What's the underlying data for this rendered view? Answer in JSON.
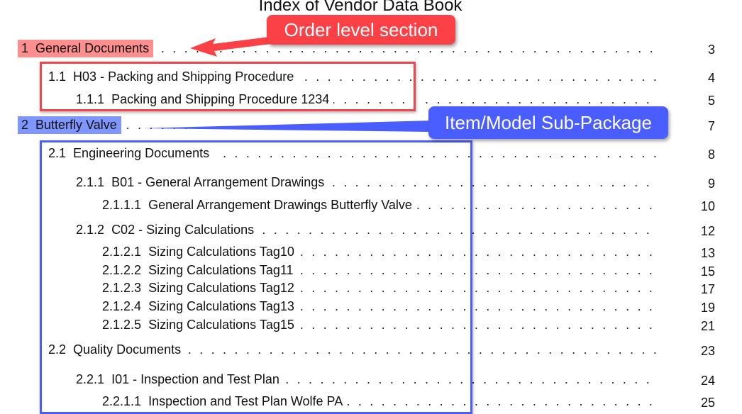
{
  "document": {
    "title": "Index of Vendor Data Book"
  },
  "toc": [
    {
      "number": "1",
      "text": "General Documents",
      "page": "3",
      "level": 1,
      "highlight": "red"
    },
    {
      "number": "1.1",
      "text": "H03 - Packing and Shipping Procedure",
      "page": "4",
      "level": 2
    },
    {
      "number": "1.1.1",
      "text": "Packing and Shipping Procedure 1234",
      "page": "5",
      "level": 3
    },
    {
      "number": "2",
      "text": "Butterfly Valve",
      "page": "7",
      "level": 1,
      "highlight": "blue"
    },
    {
      "number": "2.1",
      "text": "Engineering Documents",
      "page": "8",
      "level": 2
    },
    {
      "number": "2.1.1",
      "text": "B01 - General Arrangement Drawings",
      "page": "9",
      "level": 3
    },
    {
      "number": "2.1.1.1",
      "text": "General Arrangement Drawings Butterfly Valve",
      "page": "10",
      "level": 4
    },
    {
      "number": "2.1.2",
      "text": "C02 - Sizing Calculations",
      "page": "12",
      "level": 3
    },
    {
      "number": "2.1.2.1",
      "text": "Sizing Calculations Tag10",
      "page": "13",
      "level": 4
    },
    {
      "number": "2.1.2.2",
      "text": "Sizing Calculations Tag11",
      "page": "15",
      "level": 4
    },
    {
      "number": "2.1.2.3",
      "text": "Sizing Calculations Tag12",
      "page": "17",
      "level": 4
    },
    {
      "number": "2.1.2.4",
      "text": "Sizing Calculations Tag13",
      "page": "19",
      "level": 4
    },
    {
      "number": "2.1.2.5",
      "text": "Sizing Calculations Tag15",
      "page": "21",
      "level": 4
    },
    {
      "number": "2.2",
      "text": "Quality Documents",
      "page": "23",
      "level": 2
    },
    {
      "number": "2.2.1",
      "text": "I01 - Inspection and Test Plan",
      "page": "24",
      "level": 3
    },
    {
      "number": "2.2.1.1",
      "text": "Inspection and Test Plan Wolfe PA",
      "page": "25",
      "level": 4
    }
  ],
  "annotations": {
    "order_level": {
      "text": "Order level section",
      "color": "#fb4146"
    },
    "item_model": {
      "text": "Item/Model Sub-Package",
      "color": "#4a5dff"
    }
  },
  "dot_leader": ". . . . . . . . . . . . . . . . . . . . . . . . . . . . . . . . . . . . . . . . . . . . . . . . . . . . . . . . . . . . . . . . . . . . . . . . . . . . . . . . . . . . . . . . . . . . . . . . . . . . . . . . . . . . . . . . . . . . . . . . . . ."
}
